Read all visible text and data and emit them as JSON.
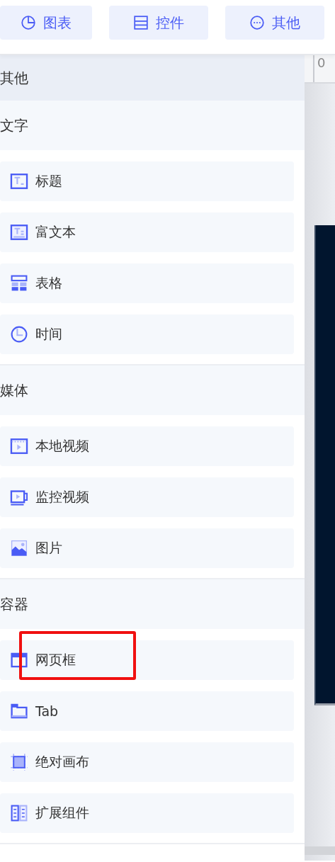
{
  "toolbar": [
    {
      "label": "图表",
      "kind": "chart"
    },
    {
      "label": "控件",
      "kind": "control"
    },
    {
      "label": "其他",
      "kind": "other"
    }
  ],
  "panel": {
    "title": "其他",
    "sections": [
      {
        "title": "文字",
        "items": [
          {
            "label": "标题",
            "kind": "title",
            "highlighted": false
          },
          {
            "label": "富文本",
            "kind": "richtext",
            "highlighted": false
          },
          {
            "label": "表格",
            "kind": "table",
            "highlighted": false
          },
          {
            "label": "时间",
            "kind": "time",
            "highlighted": false
          }
        ]
      },
      {
        "title": "媒体",
        "items": [
          {
            "label": "本地视频",
            "kind": "video",
            "highlighted": false
          },
          {
            "label": "监控视频",
            "kind": "monitor",
            "highlighted": false
          },
          {
            "label": "图片",
            "kind": "image",
            "highlighted": false
          }
        ]
      },
      {
        "title": "容器",
        "items": [
          {
            "label": "网页框",
            "kind": "iframe",
            "highlighted": true
          },
          {
            "label": "Tab",
            "kind": "tab",
            "highlighted": false
          },
          {
            "label": "绝对画布",
            "kind": "canvas",
            "highlighted": false
          },
          {
            "label": "扩展组件",
            "kind": "extend",
            "highlighted": false
          }
        ]
      }
    ]
  },
  "ruler": {
    "start": "0"
  }
}
